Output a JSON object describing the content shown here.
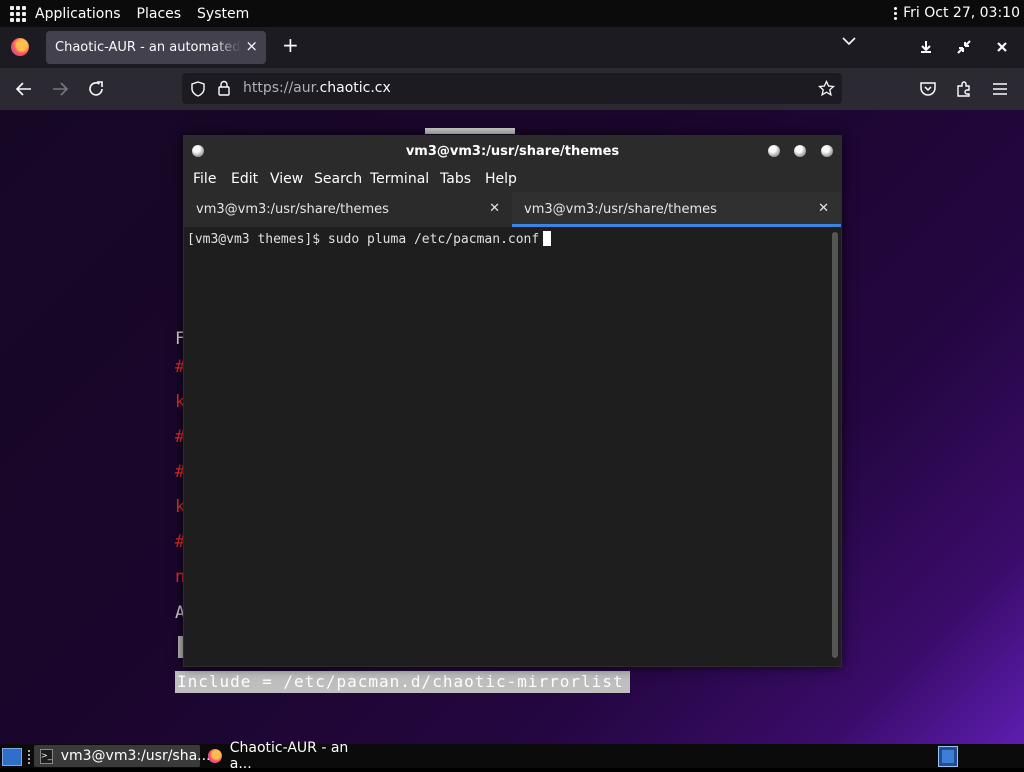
{
  "top_panel": {
    "menus": [
      "Applications",
      "Places",
      "System"
    ],
    "clock": "Fri Oct 27, 03:10"
  },
  "browser": {
    "tab_title": "Chaotic-AUR - an automated bu",
    "tab_close_icon": "×",
    "new_tab_icon": "+",
    "url_prefix": "https://aur.",
    "url_domain": "chaotic.cx"
  },
  "web_page": {
    "partial_lines": [
      {
        "text": "F",
        "color": "white"
      },
      {
        "text": "#",
        "color": "red"
      },
      {
        "text": "k",
        "color": "red"
      },
      {
        "text": "#",
        "color": "red"
      },
      {
        "text": "#",
        "color": "red"
      },
      {
        "text": "k",
        "color": "red"
      },
      {
        "text": "#",
        "color": "red"
      },
      {
        "text": "n",
        "color": "red"
      },
      {
        "text": "A",
        "color": "white"
      }
    ],
    "highlighted_line": "Include = /etc/pacman.d/chaotic-mirrorlist"
  },
  "terminal": {
    "title": "vm3@vm3:/usr/share/themes",
    "menus": [
      "File",
      "Edit",
      "View",
      "Search",
      "Terminal",
      "Tabs",
      "Help"
    ],
    "tabs": [
      {
        "label": "vm3@vm3:/usr/share/themes",
        "active": false
      },
      {
        "label": "vm3@vm3:/usr/share/themes",
        "active": true
      }
    ],
    "prompt_line": "[vm3@vm3 themes]$ sudo pluma /etc/pacman.conf"
  },
  "taskbar": {
    "tasks": [
      {
        "label": "vm3@vm3:/usr/sha...",
        "icon": "terminal-icon",
        "active": true
      },
      {
        "label": "Chaotic-AUR - an a...",
        "icon": "firefox-icon",
        "active": false
      }
    ]
  }
}
